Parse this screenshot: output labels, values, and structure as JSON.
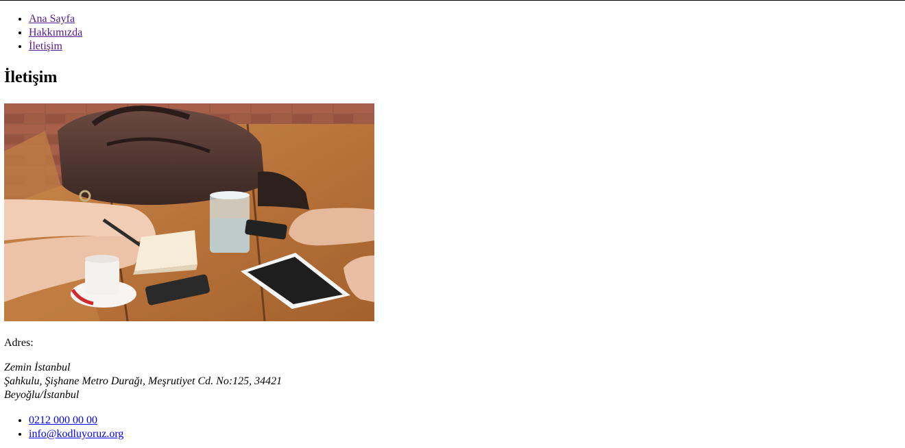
{
  "nav": {
    "items": [
      {
        "label": "Ana Sayfa"
      },
      {
        "label": "Hakkımızda"
      },
      {
        "label": "İletişim"
      }
    ]
  },
  "heading": "İletişim",
  "image": {
    "subject": "meeting-table-photo"
  },
  "address": {
    "label": "Adres:",
    "lines": [
      "Zemin İstanbul",
      "Şahkulu, Şişhane Metro Durağı, Meşrutiyet Cd. No:125, 34421",
      "Beyoğlu/İstanbul"
    ]
  },
  "contact": {
    "phone": "0212 000 00 00",
    "email": "info@kodluyoruz.org"
  },
  "colors": {
    "visited_link": "#551a8b",
    "link": "#0000ee"
  }
}
